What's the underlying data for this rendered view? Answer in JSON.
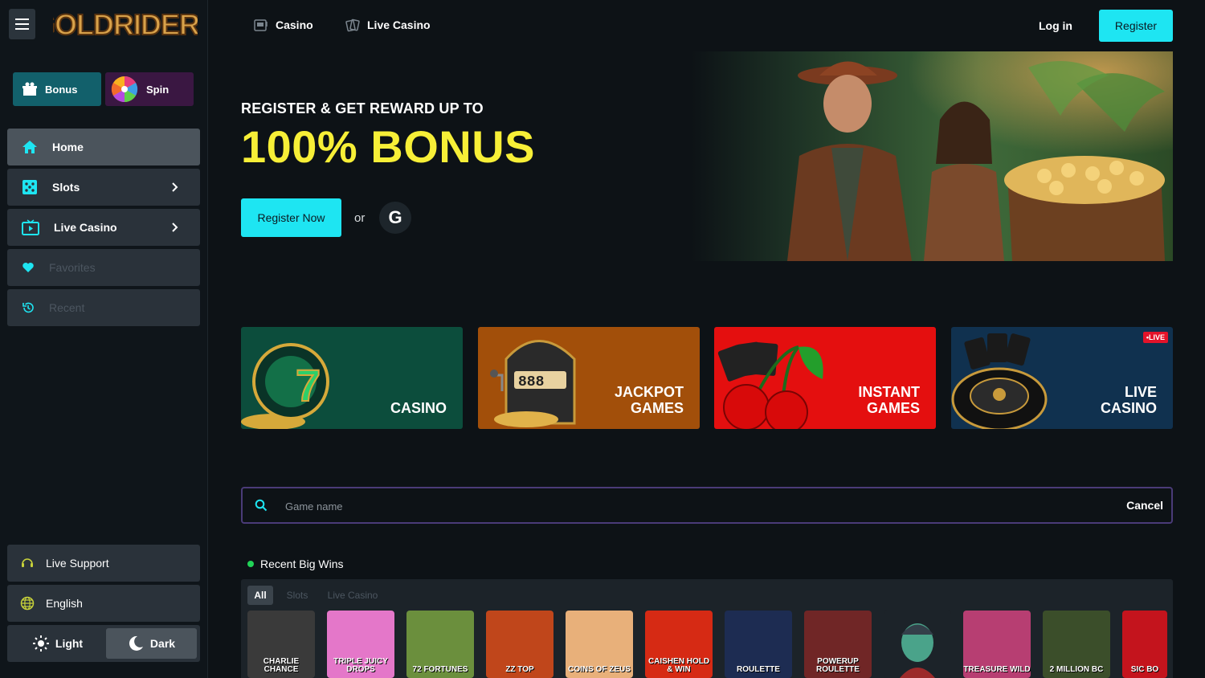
{
  "brand": {
    "logo_text": "GOLDRIDERS"
  },
  "sidebar": {
    "promos": [
      {
        "label": "Bonus",
        "icon": "gift-icon"
      },
      {
        "label": "Spin",
        "icon": "wheel-icon"
      }
    ],
    "nav": [
      {
        "label": "Home",
        "icon": "home-icon",
        "active": true
      },
      {
        "label": "Slots",
        "icon": "dice-icon",
        "has_submenu": true
      },
      {
        "label": "Live Casino",
        "icon": "tv-icon",
        "has_submenu": true
      },
      {
        "label": "Favorites",
        "icon": "heart-icon",
        "disabled": true
      },
      {
        "label": "Recent",
        "icon": "history-icon",
        "disabled": true
      }
    ],
    "bottom": {
      "support_label": "Live Support",
      "language_label": "English",
      "theme_light": "Light",
      "theme_dark": "Dark",
      "theme_selected": "Dark"
    }
  },
  "topnav": {
    "casino": "Casino",
    "live_casino": "Live Casino",
    "login": "Log in",
    "register": "Register"
  },
  "hero": {
    "subtitle": "REGISTER & GET REWARD UP TO",
    "title": "100% BONUS",
    "cta": "Register Now",
    "or": "or",
    "google_letter": "G"
  },
  "categories": [
    {
      "line1": "",
      "line2": "CASINO",
      "color": "#0c4d3c"
    },
    {
      "line1": "JACKPOT",
      "line2": "GAMES",
      "color": "#a24f0a"
    },
    {
      "line1": "INSTANT",
      "line2": "GAMES",
      "color": "#e40f0f"
    },
    {
      "line1": "LIVE",
      "line2": "CASINO",
      "color": "#10314f",
      "badge": "•LIVE"
    }
  ],
  "search": {
    "placeholder": "Game name",
    "cancel": "Cancel"
  },
  "recent_wins": {
    "title": "Recent Big Wins",
    "tabs": [
      "All",
      "Slots",
      "Live Casino"
    ],
    "active_tab": "All",
    "games": [
      {
        "label": "CHARLIE CHANCE",
        "color": "#3a3a3a"
      },
      {
        "label": "TRIPLE JUICY DROPS",
        "color": "#e477c9"
      },
      {
        "label": "72 FORTUNES",
        "color": "#6b8f3d"
      },
      {
        "label": "ZZ TOP",
        "color": "#c0461b"
      },
      {
        "label": "COINS OF ZEUS",
        "color": "#e8b07a"
      },
      {
        "label": "CAISHEN HOLD & WIN",
        "color": "#d62a14"
      },
      {
        "label": "ROULETTE",
        "color": "#1d2c52"
      },
      {
        "label": "POWERUP ROULETTE",
        "color": "#702626"
      },
      {
        "label": "",
        "color": "#1c2329"
      },
      {
        "label": "TREASURE WILD",
        "color": "#b73e72"
      },
      {
        "label": "2 MILLION BC",
        "color": "#3b4e2a"
      },
      {
        "label": "SIC BO",
        "color": "#c4141d"
      }
    ]
  }
}
